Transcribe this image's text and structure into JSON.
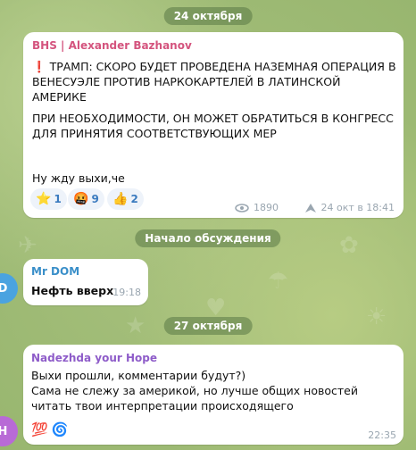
{
  "dates": {
    "first": "24 октября",
    "second": "27 октября"
  },
  "discussion_label": "Начало обсуждения",
  "post": {
    "author": "BHS | Alexander Bazhanov",
    "author_color": "#d4547e",
    "headline_mark": "❗",
    "headline": "ТРАМП: СКОРО БУДЕТ ПРОВЕДЕНА НАЗЕМНАЯ ОПЕРАЦИЯ В ВЕНЕСУЭЛЕ ПРОТИВ НАРКОКАРТЕЛЕЙ В ЛАТИНСКОЙ АМЕРИКЕ",
    "body1": "ПРИ НЕОБХОДИМОСТИ, ОН МОЖЕТ ОБРАТИТЬСЯ В КОНГРЕСС ДЛЯ ПРИНЯТИЯ СООТВЕТСТВУЮЩИХ МЕР",
    "body2": "Ну жду выхи,че",
    "reactions": [
      {
        "emoji": "⭐",
        "count": "1"
      },
      {
        "emoji": "🤬",
        "count": "9"
      },
      {
        "emoji": "👍",
        "count": "2"
      }
    ],
    "views": "1890",
    "views_icon": "eye-icon",
    "forward_icon": "share-arrow-icon",
    "time": "24 окт в 18:41"
  },
  "comment1": {
    "author": "Mr DOM",
    "author_color": "#3a8fc9",
    "text": "Нефть вверх",
    "time": "19:18",
    "avatar_initial": "D",
    "avatar_color": "#4aa3e0"
  },
  "comment2": {
    "author": "Nadezhda your Hope",
    "author_color": "#8e5cc9",
    "line1": "Выхи прошли, комментарии будут?)",
    "line2": "Сама не слежу за америкой, но лучше общих новостей читать твои интерпретации происходящего",
    "reactions": [
      {
        "emoji": "💯"
      },
      {
        "emoji": "🌀"
      }
    ],
    "time": "22:35",
    "avatar_initial": "H",
    "avatar_color": "#b86ad6"
  }
}
